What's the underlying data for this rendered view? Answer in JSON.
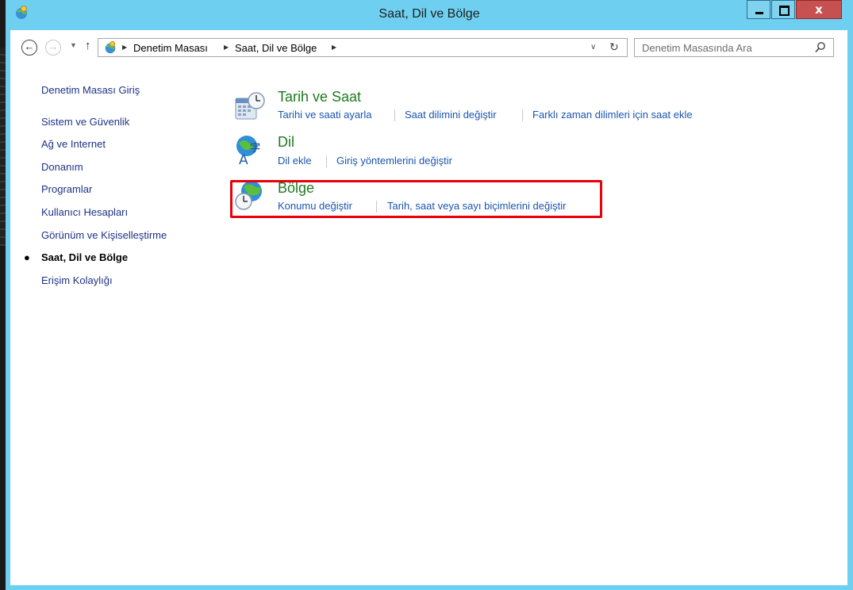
{
  "window": {
    "title": "Saat, Dil ve Bölge"
  },
  "controls": {
    "close_glyph": "x"
  },
  "nav": {
    "breadcrumb": [
      "Denetim Masası",
      "Saat, Dil ve Bölge"
    ],
    "search_placeholder": "Denetim Masasında Ara"
  },
  "sidebar": {
    "items": [
      {
        "label": "Denetim Masası Giriş"
      },
      {
        "label": "Sistem ve Güvenlik"
      },
      {
        "label": "Ağ ve Internet"
      },
      {
        "label": "Donanım"
      },
      {
        "label": "Programlar"
      },
      {
        "label": "Kullanıcı Hesapları"
      },
      {
        "label": "Görünüm ve Kişiselleştirme"
      },
      {
        "label": "Saat, Dil ve Bölge",
        "current": true
      },
      {
        "label": "Erişim Kolaylığı"
      }
    ]
  },
  "categories": [
    {
      "title": "Tarih ve Saat",
      "icon": "calendar-clock-icon",
      "links": [
        "Tarihi ve saati ayarla",
        "Saat dilimini değiştir",
        "Farklı zaman dilimleri için saat ekle"
      ]
    },
    {
      "title": "Dil",
      "icon": "language-globe-icon",
      "links": [
        "Dil ekle",
        "Giriş yöntemlerini değiştir"
      ]
    },
    {
      "title": "Bölge",
      "icon": "region-globe-clock-icon",
      "links": [
        "Konumu değiştir",
        "Tarih, saat veya sayı biçimlerini değiştir"
      ]
    }
  ],
  "colors": {
    "window_frame": "#6fcff0",
    "category_title": "#1e7a1e",
    "link": "#1a55b0",
    "highlight": "#e8000b"
  }
}
